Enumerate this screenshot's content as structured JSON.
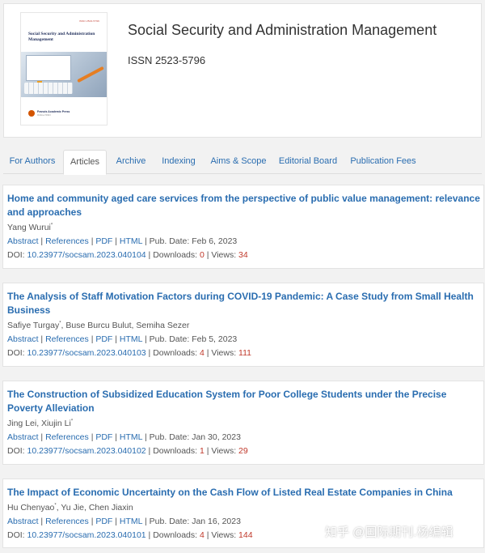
{
  "journal": {
    "title": "Social Security and Administration Management",
    "issn": "ISSN 2523-5796",
    "cover": {
      "code": "ISSN 2523-5796",
      "title": "Social Security and Administration Management",
      "publisher": "Francis Academic Press",
      "publisher_sub": "Online ISSN"
    }
  },
  "tabs": [
    {
      "label": "For Authors",
      "active": false
    },
    {
      "label": "Articles",
      "active": true
    },
    {
      "label": "Archive",
      "active": false
    },
    {
      "label": "Indexing",
      "active": false
    },
    {
      "label": "Aims & Scope",
      "active": false
    },
    {
      "label": "Editorial Board",
      "active": false
    },
    {
      "label": "Publication Fees",
      "active": false
    }
  ],
  "links": {
    "abstract": "Abstract",
    "references": "References",
    "pdf": "PDF",
    "html": "HTML",
    "doi_prefix": "DOI: ",
    "downloads_label": "Downloads: ",
    "views_label": "Views: ",
    "pub_date_prefix": "Pub. Date: "
  },
  "articles": [
    {
      "title": "Home and community aged care services from the perspective of public value management: relevance and approaches",
      "authors": [
        {
          "name": "Yang Wurui",
          "star": true
        }
      ],
      "pub_date": "Feb 6, 2023",
      "doi": "10.23977/socsam.2023.040104",
      "downloads": "0",
      "views": "34"
    },
    {
      "title": "The Analysis of Staff Motivation Factors during COVID-19 Pandemic: A Case Study from Small Health Business",
      "authors": [
        {
          "name": "Safiye Turgay",
          "star": true
        },
        {
          "name": "Buse Burcu Bulut",
          "star": false
        },
        {
          "name": "Semiha Sezer",
          "star": false
        }
      ],
      "pub_date": "Feb 5, 2023",
      "doi": "10.23977/socsam.2023.040103",
      "downloads": "4",
      "views": "111"
    },
    {
      "title": "The Construction of Subsidized Education System for Poor College Students under the Precise Poverty Alleviation",
      "authors": [
        {
          "name": "Jing Lei",
          "star": false
        },
        {
          "name": "Xiujin Li",
          "star": true
        }
      ],
      "pub_date": "Jan 30, 2023",
      "doi": "10.23977/socsam.2023.040102",
      "downloads": "1",
      "views": "29"
    },
    {
      "title": "The Impact of Economic Uncertainty on the Cash Flow of Listed Real Estate Companies in China",
      "authors": [
        {
          "name": "Hu Chenyao",
          "star": true
        },
        {
          "name": "Yu Jie",
          "star": false
        },
        {
          "name": "Chen Jiaxin",
          "star": false
        }
      ],
      "pub_date": "Jan 16, 2023",
      "doi": "10.23977/socsam.2023.040101",
      "downloads": "4",
      "views": "144"
    }
  ],
  "watermark": "知乎 @国际期刊.杨编辑",
  "colors": {
    "link": "#2a6db0",
    "count": "#c0392b",
    "background": "#f2f2f2"
  }
}
